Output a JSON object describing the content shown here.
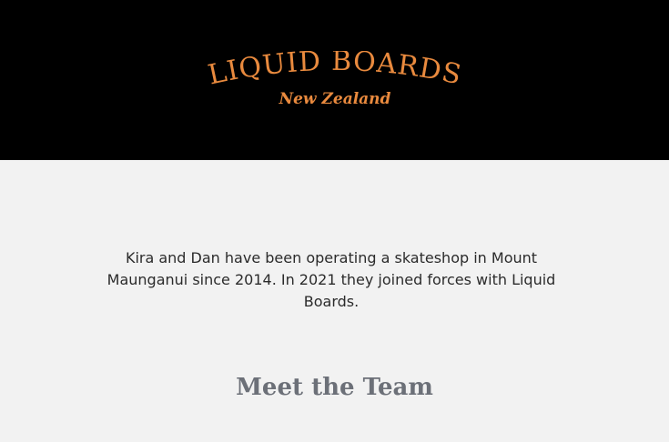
{
  "header": {
    "brand_name": "LIQUID BOARDS",
    "brand_region": "New Zealand",
    "brand_color": "#e98a3e",
    "background": "#000000"
  },
  "main": {
    "intro_text": "Kira and Dan have been operating a skateshop in Mount Maunganui since 2014. In 2021 they joined forces with Liquid Boards.",
    "team_heading": "Meet the Team",
    "background": "#f2f2f2"
  }
}
